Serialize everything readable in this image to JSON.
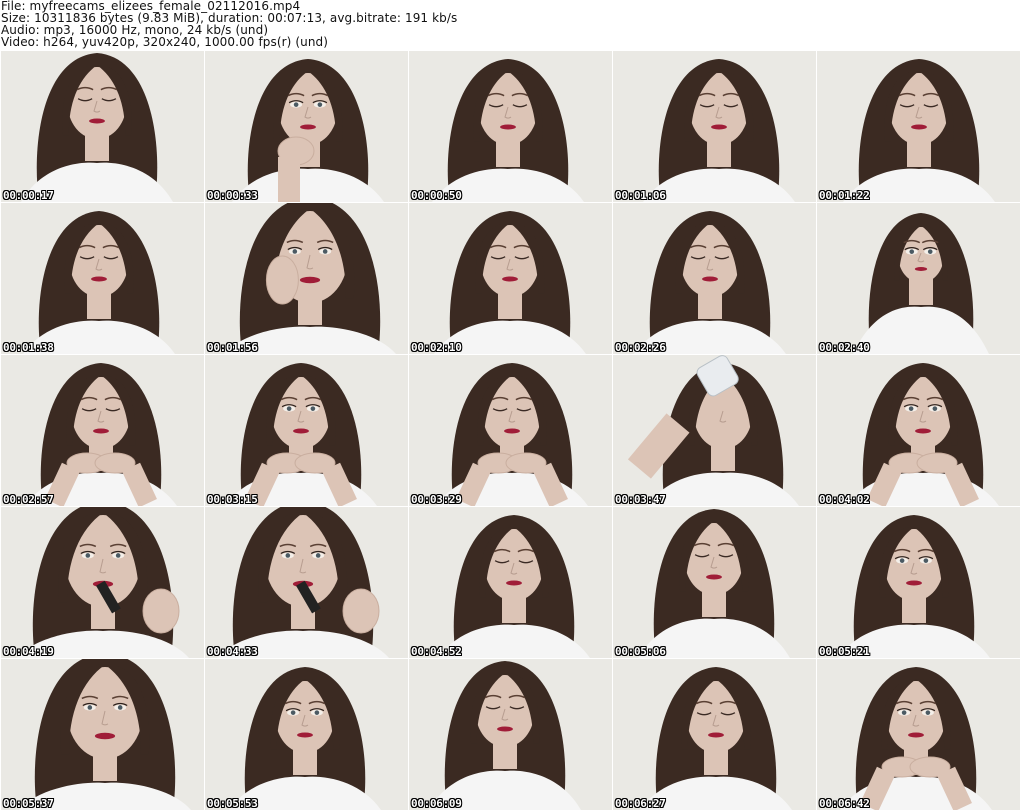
{
  "header": {
    "file_line": "File: myfreecams_elizees_female_02112016.mp4",
    "size_line": "Size: 10311836 bytes (9.83 MiB), duration: 00:07:13, avg.bitrate: 191 kb/s",
    "audio_line": "Audio: mp3, 16000 Hz, mono, 24 kb/s (und)",
    "video_line": "Video: h264, yuv420p, 320x240, 1000.00 fps(r) (und)"
  },
  "colors": {
    "background": "#ffffff",
    "room_wall": "#f1efeb",
    "hair": "#3b2a22",
    "skin": "#dcc4b6",
    "shirt": "#f5f5f5",
    "lips": "#a01d38",
    "timestamp_text": "#ffffff",
    "timestamp_outline": "#000000"
  },
  "frames": [
    {
      "time": "00:00:17",
      "pose": "looking-down",
      "hands": "none"
    },
    {
      "time": "00:00:33",
      "pose": "facing",
      "hands": "chin-hand"
    },
    {
      "time": "00:00:50",
      "pose": "eyes-closed",
      "hands": "none"
    },
    {
      "time": "00:01:06",
      "pose": "eyes-closed",
      "hands": "none"
    },
    {
      "time": "00:01:22",
      "pose": "eyes-closed",
      "hands": "none"
    },
    {
      "time": "00:01:38",
      "pose": "eyes-closed",
      "hands": "none"
    },
    {
      "time": "00:01:56",
      "pose": "facing-close",
      "hands": "cheek-hand"
    },
    {
      "time": "00:02:10",
      "pose": "eyes-closed",
      "hands": "none"
    },
    {
      "time": "00:02:26",
      "pose": "eyes-closed",
      "hands": "none"
    },
    {
      "time": "00:02:40",
      "pose": "facing-far",
      "hands": "none"
    },
    {
      "time": "00:02:57",
      "pose": "eyes-closed",
      "hands": "chin-rest"
    },
    {
      "time": "00:03:15",
      "pose": "facing",
      "hands": "chin-rest"
    },
    {
      "time": "00:03:29",
      "pose": "eyes-closed",
      "hands": "chin-rest"
    },
    {
      "time": "00:03:47",
      "pose": "drinking",
      "hands": "bottle"
    },
    {
      "time": "00:04:02",
      "pose": "facing",
      "hands": "chin-rest"
    },
    {
      "time": "00:04:19",
      "pose": "facing-close",
      "hands": "lipstick"
    },
    {
      "time": "00:04:33",
      "pose": "facing-close",
      "hands": "lipstick"
    },
    {
      "time": "00:04:52",
      "pose": "eyes-closed",
      "hands": "none"
    },
    {
      "time": "00:05:06",
      "pose": "looking-down",
      "hands": "none"
    },
    {
      "time": "00:05:21",
      "pose": "facing",
      "hands": "none"
    },
    {
      "time": "00:05:37",
      "pose": "facing-close",
      "hands": "none"
    },
    {
      "time": "00:05:53",
      "pose": "facing",
      "hands": "none"
    },
    {
      "time": "00:06:09",
      "pose": "looking-down",
      "hands": "none"
    },
    {
      "time": "00:06:27",
      "pose": "eyes-closed",
      "hands": "none"
    },
    {
      "time": "00:06:42",
      "pose": "facing",
      "hands": "chin-rest"
    }
  ]
}
